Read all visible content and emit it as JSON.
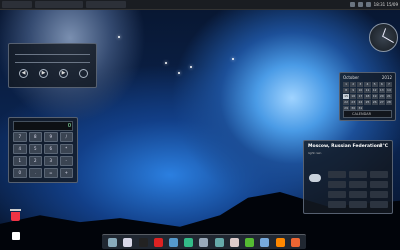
{
  "topbar": {
    "clock": "18:31 15/09"
  },
  "media": {
    "buttons": [
      "◀",
      "▶",
      "▶"
    ]
  },
  "calculator": {
    "display": "0",
    "keys": [
      "7",
      "8",
      "9",
      "/",
      "4",
      "5",
      "6",
      "*",
      "1",
      "2",
      "3",
      "-",
      "0",
      ".",
      "=",
      "+"
    ]
  },
  "calendar": {
    "month": "October",
    "year": "2012",
    "days": [
      "1",
      "2",
      "3",
      "4",
      "5",
      "6",
      "7",
      "8",
      "9",
      "10",
      "11",
      "12",
      "13",
      "14",
      "15",
      "16",
      "17",
      "18",
      "19",
      "20",
      "21",
      "22",
      "23",
      "24",
      "25",
      "26",
      "27",
      "28",
      "29",
      "30",
      "31"
    ],
    "today_index": 14,
    "footer": "CALENDAR"
  },
  "weather": {
    "city": "Moscow, Russian Federation",
    "temp": "8°C",
    "subtitle": "light rain"
  },
  "dock": {
    "icons": [
      "finder-icon",
      "folder-icon",
      "terminal-icon",
      "opera-icon",
      "mail-icon",
      "chat-icon",
      "monitor-icon",
      "image-icon",
      "notes-icon",
      "green-icon",
      "media-icon",
      "vlc-icon",
      "firefox-icon"
    ],
    "colors": [
      "#8ab",
      "#d8d8e8",
      "#222",
      "#d22",
      "#59c",
      "#3b8",
      "#9ab",
      "#6aa",
      "#dcc",
      "#5b3",
      "#7ad",
      "#f80",
      "#e63"
    ]
  }
}
